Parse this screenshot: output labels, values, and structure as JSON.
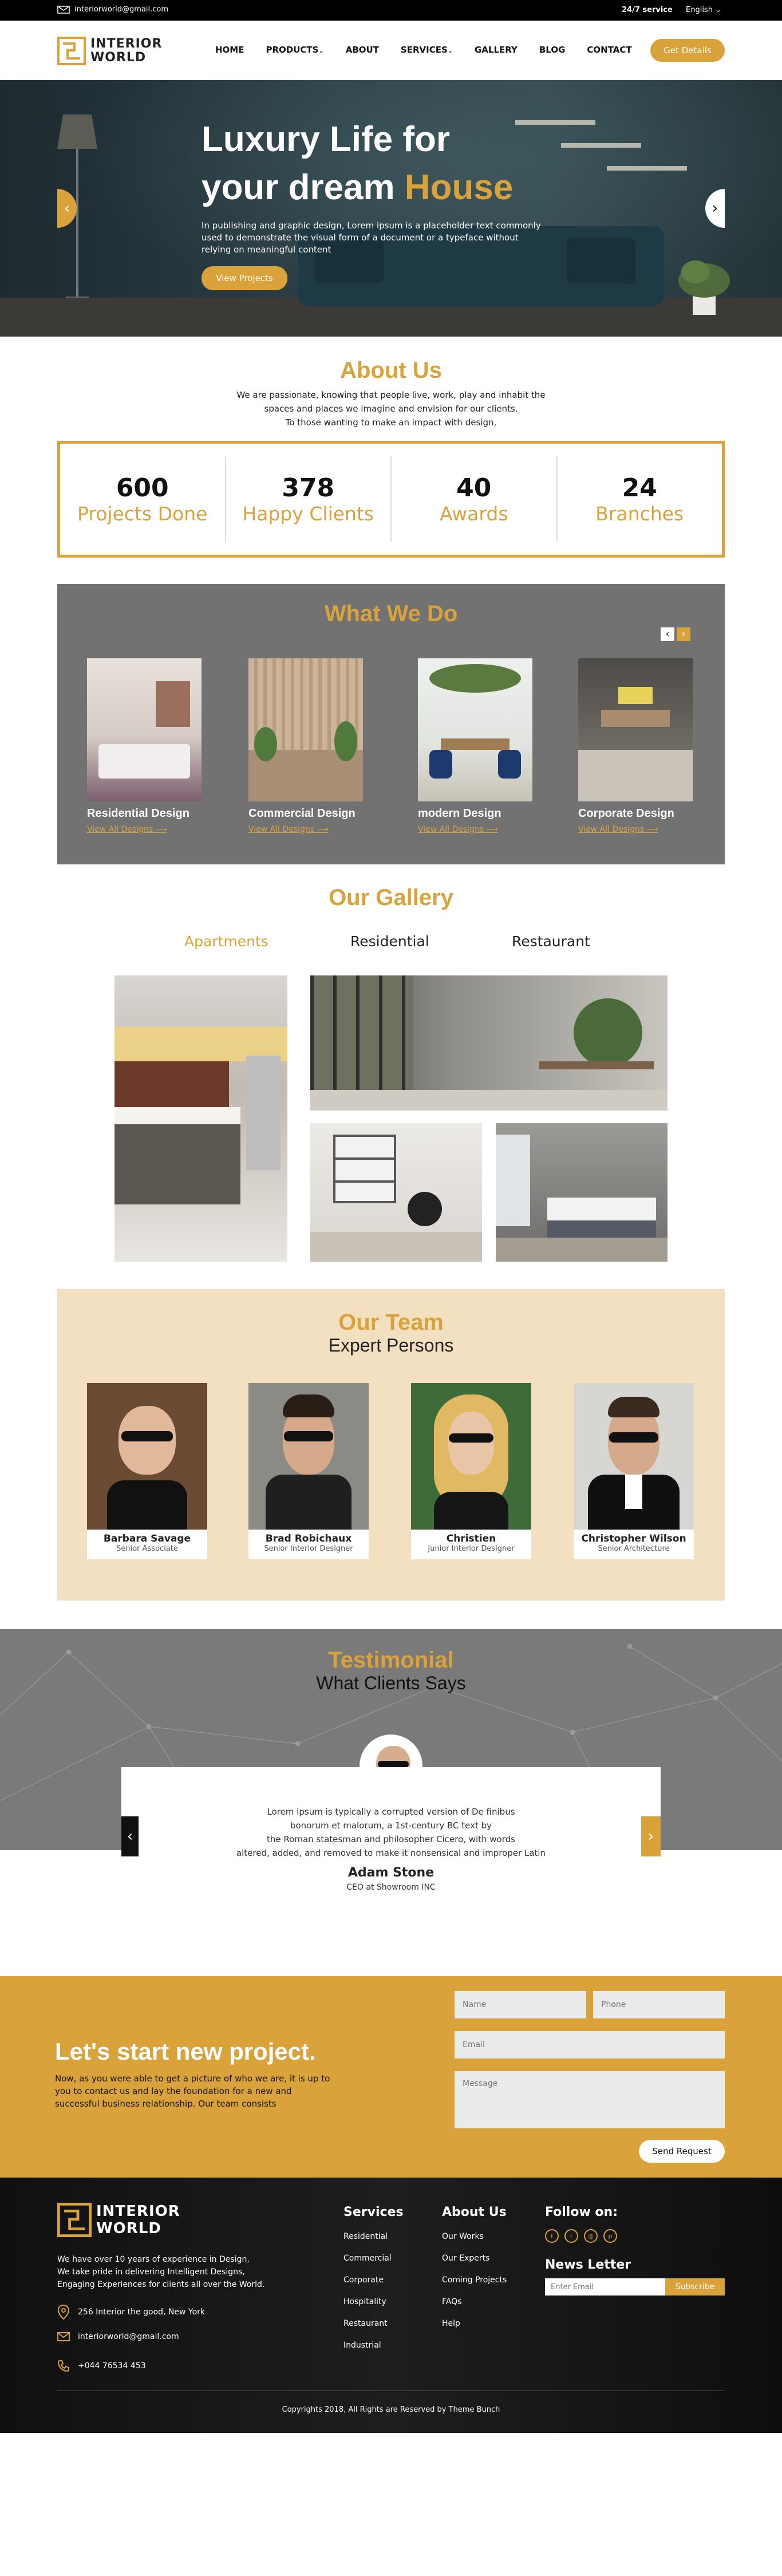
{
  "topbar": {
    "email": "interiorworld@gmail.com",
    "service": "24/7 service",
    "language": "English"
  },
  "nav": {
    "logo_line1": "INTERIOR",
    "logo_line2": "WORLD",
    "items": [
      "HOME",
      "PRODUCTS",
      "ABOUT",
      "SERVICES",
      "GALLERY",
      "BLOG",
      "CONTACT"
    ],
    "cta": "Get Details"
  },
  "hero": {
    "title_line1": "Luxury Life for",
    "title_line2_white": "your dream",
    "title_line2_gold": "House",
    "text": "In publishing and graphic design, Lorem ipsum is a placeholder text commonly used to demonstrate the visual form of a document or a typeface without relying on meaningful content",
    "button": "View Projects"
  },
  "about": {
    "title": "About Us",
    "text_line1": "We are passionate, knowing that people live, work, play and inhabit the",
    "text_line2": "spaces and places we imagine and envision for our clients.",
    "text_line3": "To those wanting to make an impact with design,",
    "stats": [
      {
        "num": "600",
        "label": "Projects Done"
      },
      {
        "num": "378",
        "label": "Happy Clients"
      },
      {
        "num": "40",
        "label": "Awards"
      },
      {
        "num": "24",
        "label": "Branches"
      }
    ]
  },
  "what_we_do": {
    "title": "What We Do",
    "link": "View All Designs",
    "cards": [
      "Residential Design",
      "Commercial Design",
      "modern Design",
      "Corporate Design"
    ]
  },
  "gallery": {
    "title": "Our Gallery",
    "tabs": [
      "Apartments",
      "Residential",
      "Restaurant"
    ]
  },
  "team": {
    "title": "Our Team",
    "subtitle": "Expert Persons",
    "members": [
      {
        "name": "Barbara Savage",
        "role": "Senior Associate"
      },
      {
        "name": "Brad Robichaux",
        "role": "Senior Interior Designer"
      },
      {
        "name": "Christien",
        "role": "Junior Interior Designer"
      },
      {
        "name": "Christopher Wilson",
        "role": "Senior Architecture"
      }
    ]
  },
  "testimonial": {
    "title": "Testimonial",
    "subtitle": "What Clients Says",
    "lines": [
      "Lorem ipsum is typically a corrupted version of De finibus",
      "bonorum et malorum, a 1st-century BC text by",
      "the Roman statesman and philosopher Cicero, with words",
      "altered, added, and removed to make it nonsensical and improper Latin"
    ],
    "name": "Adam Stone",
    "role": "CEO at Showroom INC"
  },
  "cta": {
    "title": "Let's start new project.",
    "text_line1": "Now, as you were able to get a picture of who we are, it is up to",
    "text_line2": "you to contact us and lay the foundation for a new and",
    "text_line3": "successful business relationship. Our team consists",
    "name_placeholder": "Name",
    "phone_placeholder": "Phone",
    "email_placeholder": "Email",
    "message_placeholder": "Message",
    "send": "Send Request"
  },
  "footer": {
    "logo_line1": "INTERIOR",
    "logo_line2": "WORLD",
    "about_line1": "We have over 10 years of experience in Design,",
    "about_line2": "We take pride in delivering Intelligent Designs,",
    "about_line3": "Engaging Experiences for clients all over the World.",
    "address": "256 Interior the good, New York",
    "email": "interiorworld@gmail.com",
    "phone": "+044 76534 453",
    "services_title": "Services",
    "services": [
      "Residential",
      "Commercial",
      "Corporate",
      "Hospitality",
      "Restaurant",
      "Industrial"
    ],
    "about_title": "About Us",
    "about_links": [
      "Our Works",
      "Our Experts",
      "Coming Projects",
      "FAQs",
      "Help"
    ],
    "follow_title": "Follow on:",
    "newsletter_title": "News Letter",
    "newsletter_placeholder": "Enter Email",
    "subscribe": "Subscribe",
    "copyright": "Copyrights 2018, All Rights are Reserved by Theme Bunch"
  },
  "colors": {
    "accent": "#d9a23b",
    "dark": "#141414",
    "panel_gray": "#727272",
    "team_bg": "#f3e0c1"
  }
}
